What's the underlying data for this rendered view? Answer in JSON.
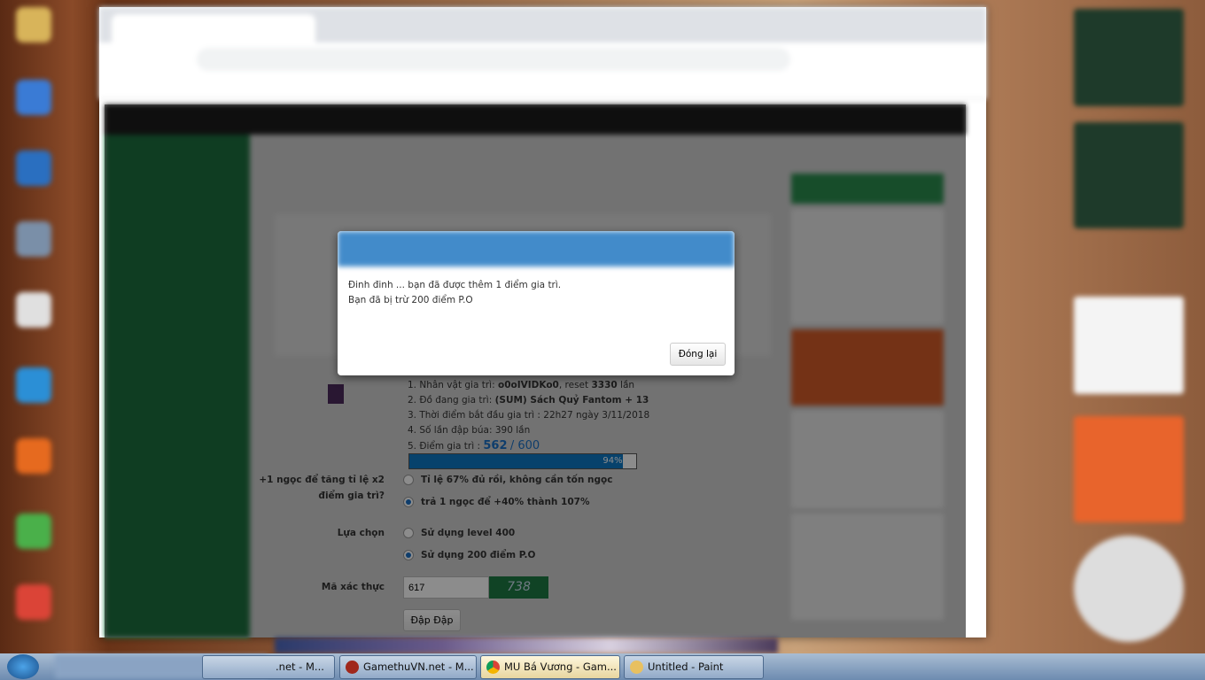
{
  "dialog": {
    "message_line1": "Đinh đinh ... bạn đã được thêm 1 điểm gia trì.",
    "message_line2": "Bạn đã bị trừ 200 điểm P.O",
    "close_button": "Đóng lại"
  },
  "info": {
    "line1_prefix": "1. Nhân vật gia trì: ",
    "line1_char": "o0oIVIDKo0",
    "line1_mid": ", reset ",
    "line1_resets": "3330",
    "line1_suffix": " lần",
    "line2_prefix": "2. Đồ đang gia trì: ",
    "line2_item": "(SUM) Sách Quỷ Fantom + 13",
    "line3": "3. Thời điểm bắt đầu gia trì : 22h27 ngày 3/11/2018",
    "line4": "4. Số lần đập búa: 390 lần",
    "line5_prefix": "5. Điểm gia trì : ",
    "points": "562",
    "points_max": "/ 600",
    "progress_percent": 94,
    "progress_label": "94%"
  },
  "form": {
    "gem_label_1": "+1 ngọc để tăng tỉ lệ x2",
    "gem_label_2": "điểm gia trì?",
    "gem_options": [
      {
        "label": "Tỉ lệ 67% đủ rồi, không cần tốn ngọc",
        "selected": false
      },
      {
        "label": "trả 1 ngọc để +40% thành 107%",
        "selected": true
      }
    ],
    "choice_label": "Lựa chọn",
    "choice_options": [
      {
        "label": "Sử dụng level 400",
        "selected": false
      },
      {
        "label": "Sử dụng 200 điểm P.O",
        "selected": true
      }
    ],
    "captcha_label": "Mã xác thực",
    "captcha_value": "617",
    "captcha_image_text": "738",
    "submit": "Đập Đập"
  },
  "taskbar": {
    "items": [
      ".net - M...",
      "GamethuVN.net - M...",
      "MU Bá Vương - Gam...",
      "Untitled - Paint"
    ],
    "active": 2
  },
  "colors": {
    "modal_header": "#428bca",
    "sidebar": "#1f7a44",
    "progress": "#0d78c5",
    "accent_orange": "#e8642c"
  }
}
